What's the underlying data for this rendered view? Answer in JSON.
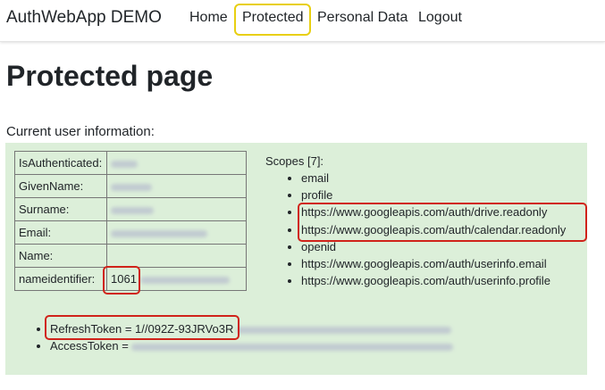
{
  "navbar": {
    "brand": "AuthWebApp DEMO",
    "links": [
      "Home",
      "Protected",
      "Personal Data",
      "Logout"
    ]
  },
  "page": {
    "title": "Protected page",
    "info_label": "Current user information:"
  },
  "claims": [
    {
      "key": "IsAuthenticated:",
      "value": ""
    },
    {
      "key": "GivenName:",
      "value": ""
    },
    {
      "key": "Surname:",
      "value": ""
    },
    {
      "key": "Email:",
      "value": ""
    },
    {
      "key": "Name:",
      "value": ""
    },
    {
      "key": "nameidentifier:",
      "value": "1061"
    }
  ],
  "scopes": {
    "title": "Scopes [7]:",
    "items": [
      "email",
      "profile",
      "https://www.googleapis.com/auth/drive.readonly",
      "https://www.googleapis.com/auth/calendar.readonly",
      "openid",
      "https://www.googleapis.com/auth/userinfo.email",
      "https://www.googleapis.com/auth/userinfo.profile"
    ]
  },
  "tokens": {
    "refresh_label": "RefreshToken = 1//092Z-93JRVo3R",
    "access_label": "AccessToken = "
  },
  "colors": {
    "panel_bg": "#dcefd9",
    "nav_highlight": "#e8cf12",
    "annotation_red": "#d0231a"
  }
}
